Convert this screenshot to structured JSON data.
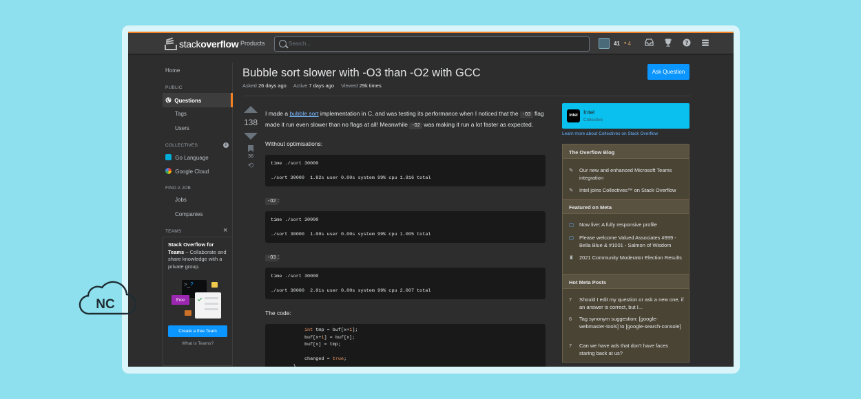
{
  "topbar": {
    "logo_light": "stack",
    "logo_bold": "overflow",
    "products": "Products",
    "search_placeholder": "Search...",
    "reputation": "41",
    "bronze_dot": "●",
    "bronze_count": "4",
    "icons": [
      "avatar-icon",
      "inbox-icon",
      "trophy-icon",
      "help-icon",
      "site-switcher-icon"
    ]
  },
  "sidebar": {
    "home": "Home",
    "public_header": "PUBLIC",
    "questions": "Questions",
    "tags": "Tags",
    "users": "Users",
    "collectives_header": "COLLECTIVES",
    "collectives": [
      "Go Language",
      "Google Cloud"
    ],
    "findjob_header": "FIND A JOB",
    "jobs": "Jobs",
    "companies": "Companies",
    "teams_header": "TEAMS",
    "teams_title_bold": "Stack Overflow for Teams",
    "teams_title_rest": " – Collaborate and share knowledge with a private group.",
    "free_badge": "Free",
    "create_team": "Create a free Team",
    "what_is_teams": "What is Teams?"
  },
  "question": {
    "title": "Bubble sort slower with -O3 than -O2 with GCC",
    "ask_button": "Ask Question",
    "asked_label": "Asked",
    "asked_value": "26 days ago",
    "active_label": "Active",
    "active_value": "7 days ago",
    "viewed_label": "Viewed",
    "viewed_value": "29k times",
    "score": "138",
    "bookmarks": "36",
    "body_p1_a": "I made a ",
    "body_link": "bubble sort",
    "body_p1_b": " implementation in C, and was testing its performance when I noticed that the ",
    "body_code1": "-O3",
    "body_p1_c": " flag made it run even slower than no flags at all! Meanwhile ",
    "body_code2": "-O2",
    "body_p1_d": " was making it run a lot faster as expected.",
    "without_opt": "Without optimisations:",
    "code_block1": "time ./sort 30000\n\n./sort 30000  1.82s user 0.00s system 99% cpu 1.816 total",
    "label_o2": "-O2",
    "code_block2": "time ./sort 30000\n\n./sort 30000  1.00s user 0.00s system 99% cpu 1.005 total",
    "label_o3": "-O3",
    "code_block3": "time ./sort 30000\n\n./sort 30000  2.01s user 0.00s system 99% cpu 2.007 total",
    "the_code": "The code:",
    "code_lines": [
      "            int tmp = buf[x+1];",
      "            buf[x+1] = buf[x];",
      "            buf[x] = tmp;",
      "",
      "            changed = true;",
      "        }"
    ]
  },
  "collective": {
    "logo_text": "intel",
    "name": "Intel",
    "sub": "Collective",
    "learn_more": "Learn more about Collectives on Stack Overflow"
  },
  "sidebar_widget": {
    "blog_header": "The Overflow Blog",
    "blog_items": [
      "Our new and enhanced Microsoft Teams integration",
      "Intel joins Collectives™ on Stack Overflow"
    ],
    "meta_header": "Featured on Meta",
    "meta_items": [
      "Now live: A fully responsive profile",
      "Please welcome Valued Associates #999 - Bella Blue & #1001 - Salmon of Wisdom",
      "2021 Community Moderator Election Results"
    ],
    "hot_header": "Hot Meta Posts",
    "hot_items": [
      {
        "count": "7",
        "text": "Should I edit my question or ask a new one, if an answer is correct, but I..."
      },
      {
        "count": "6",
        "text": "Tag synonym suggestion: [google-webmaster-tools] to [google-search-console]"
      },
      {
        "count": "7",
        "text": "Can we have ads that don't have faces staring back at us?"
      }
    ]
  },
  "watermark": {
    "text": "NC"
  },
  "colors": {
    "accent": "#f48225",
    "link": "#0a95ff",
    "bg": "#2d2d2d",
    "outer": "#8fe0ee"
  }
}
